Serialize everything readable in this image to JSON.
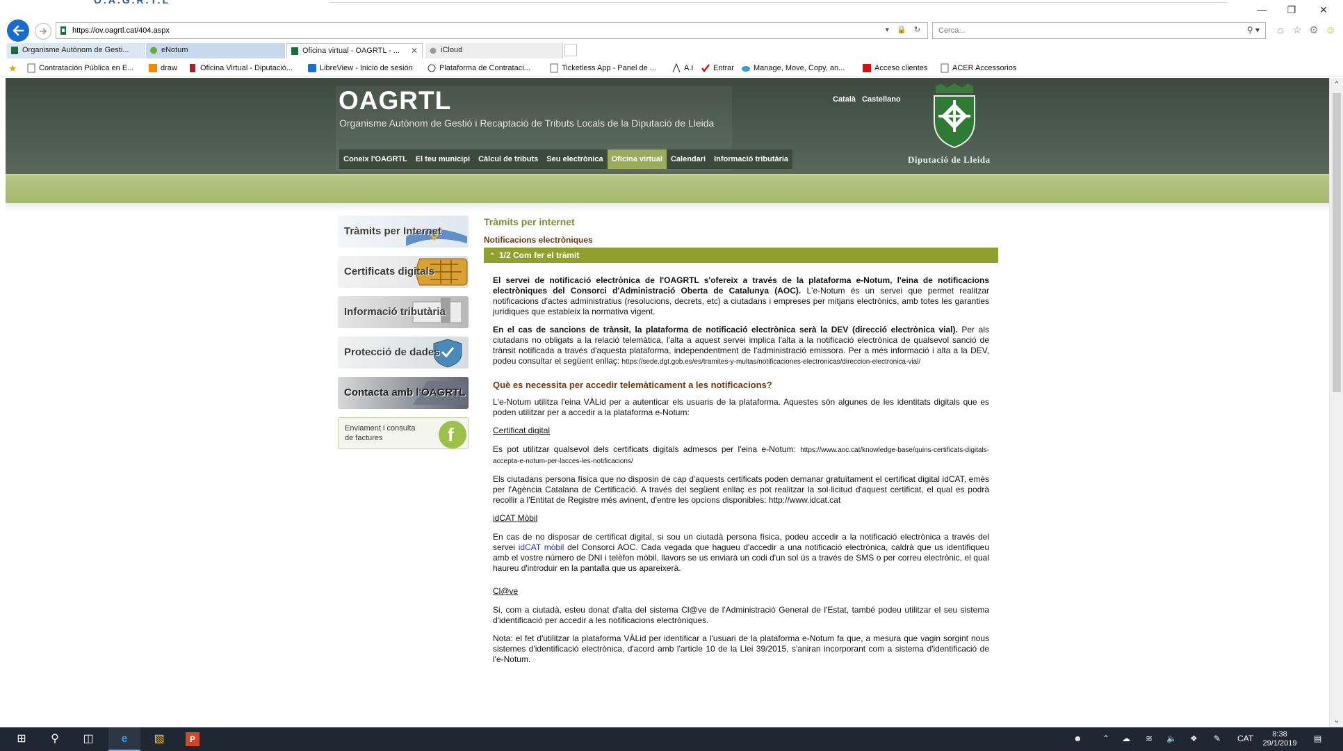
{
  "browser": {
    "url": "https://ov.oagrtl.cat/404.aspx",
    "search_placeholder": "Cerca...",
    "title_fragment": "O.A.G.R.T.L",
    "tabs": [
      {
        "label": "Organisme Autònom de Gesti..."
      },
      {
        "label": "eNotum"
      },
      {
        "label": "Oficina virtual - OAGRTL - ..."
      },
      {
        "label": "iCloud"
      }
    ],
    "favorites": [
      {
        "label": "Contratación Pública en E..."
      },
      {
        "label": "draw"
      },
      {
        "label": "Oficina Virtual - Diputació..."
      },
      {
        "label": "LibreView - Inicio de sesión"
      },
      {
        "label": "Plataforma de Contrataci..."
      },
      {
        "label": "Ticketless App - Panel de ..."
      },
      {
        "label": "A.I"
      },
      {
        "label": "Entrar"
      },
      {
        "label": "Manage, Move, Copy, an..."
      },
      {
        "label": "Acceso clientes"
      },
      {
        "label": "ACER Accessorios"
      }
    ]
  },
  "site": {
    "name": "OAGRTL",
    "subtitle": "Organisme Autònom de Gestió i Recaptació de Tributs Locals de la Diputació de Lleida",
    "languages": [
      "Català",
      "Castellano"
    ],
    "crest_label": "Diputació de Lleida",
    "nav": [
      {
        "label": "Coneix l'OAGRTL"
      },
      {
        "label": "El teu municipi"
      },
      {
        "label": "Càlcul de tributs"
      },
      {
        "label": "Seu electrònica"
      },
      {
        "label": "Oficina virtual"
      },
      {
        "label": "Calendari"
      },
      {
        "label": "Informació tributària"
      }
    ],
    "sidebar": [
      {
        "label": "Tràmits per Internet"
      },
      {
        "label": "Certificats digitals"
      },
      {
        "label": "Informació tributària"
      },
      {
        "label": "Protecció de dades"
      },
      {
        "label": "Contacta amb l'OAGRTL"
      },
      {
        "label": "Enviament i consulta de factures"
      }
    ]
  },
  "content": {
    "title": "Tràmits per internet",
    "subtitle": "Notificacions electròniques",
    "section_bar": "1/2  Com fer el tràmit",
    "p1_bold": "El servei de notificació electrònica de l'OAGRTL s'ofereix a través de la plataforma e-Notum, l'eina de notificacions electròniques del Consorci d'Administració Oberta de Catalunya (AOC).",
    "p1_rest": " L'e-Notum és un servei que permet realitzar notificacions d'actes administratius (resolucions, decrets, etc) a ciutadans i empreses per mitjans electrònics, amb totes les garanties jurídiques que estableix la normativa vigent.",
    "p2_bold": "En el cas de sancions de trànsit, la plataforma de notificació electrònica serà la DEV (direcció electrònica vial).",
    "p2_rest": " Per als ciutadans no obligats a la relació telemàtica, l'alta a aquest servei implica l'alta a la notificació electrònica de qualsevol sanció de trànsit notificada a través d'aquesta plataforma, independentment de l'administració emissora. Per a més informació i alta a la DEV, podeu consultar el següent enllaç: ",
    "p2_link": "https://sede.dgt.gob.es/es/tramites-y-multas/notificaciones-electronicas/direccion-electronica-vial/",
    "h_access": "Què es necessita per accedir telemàticament a les notificacions?",
    "p3": "L'e-Notum utilitza l'eina VÀLid per a autenticar els usuaris de la plataforma. Aquestes són algunes de les identitats digitals que es poden utilitzar per a accedir a la plataforma e-Notum:",
    "h_cert": "Certificat digital",
    "p4_text": "Es pot utilitzar qualsevol dels certificats digitals admesos per l'eina e-Notum: ",
    "p4_link": "https://www.aoc.cat/knowledge-base/quins-certificats-digitals-accepta-e-notum-per-lacces-les-notificacions/",
    "p5": "Els ciutadans persona física que no disposin de cap d'aquests certificats poden demanar gratuïtament el certificat digital idCAT, emès per l'Agència Catalana de Certificació. A través del següent enllaç es pot realitzar la sol·licitud d'aquest certificat, el qual es podrà recollir a l'Entitat de Registre més avinent, d'entre les opcions disponibles: http://www.idcat.cat",
    "h_idcat": "idCAT Mòbil",
    "p6_a": "En cas de no disposar de certificat digital, si sou un ciutadà persona física, podeu accedir a la notificació electrònica a través del servei ",
    "p6_link": "idCAT mòbil",
    "p6_b": " del Consorci AOC. Cada vegada que hagueu d'accedir a una notificació electrònica, caldrà que us identifiqueu amb el vostre número de DNI i telèfon mòbil, llavors se us enviarà un codi d'un sol ús a través de SMS o per correu electrònic, el qual haureu d'introduir en la pantalla que us apareixerà.",
    "h_clave": "Cl@ve",
    "p7": "Si, com a ciutadà, esteu donat d'alta del sistema Cl@ve de l'Administració General de l'Estat, també podeu utilitzar el seu sistema d'identificació per accedir a les notificacions electròniques.",
    "p8": "Nota: el fet d'utilitzar la plataforma VÀLid per identificar a l'usuari de la plataforma e-Notum fa que, a mesura que vagin sorgint nous sistemes d'identificació electrònica, d'acord amb l'article 10 de la Llei 39/2015, s'aniran incorporant com a sistema d'identificació de l'e-Notum."
  },
  "taskbar": {
    "lang": "CAT",
    "time": "8:38",
    "date": "29/1/2019"
  },
  "colors": {
    "header_dark": "#4e5c50",
    "nav_active": "#9aab5e",
    "section_green": "#8fa02e",
    "title_green": "#7b8f2e",
    "brown": "#6a3a10",
    "link_blue": "#1a35b8"
  }
}
